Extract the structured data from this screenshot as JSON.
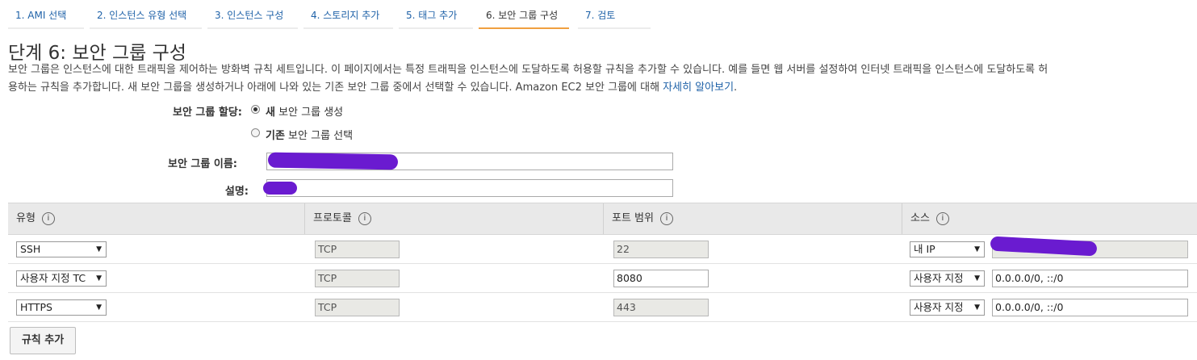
{
  "tabs": [
    {
      "label": "1. AMI 선택"
    },
    {
      "label": "2. 인스턴스 유형 선택"
    },
    {
      "label": "3. 인스턴스 구성"
    },
    {
      "label": "4. 스토리지 추가"
    },
    {
      "label": "5. 태그 추가"
    },
    {
      "label": "6. 보안 그룹 구성"
    },
    {
      "label": "7. 검토"
    }
  ],
  "page": {
    "title": "단계 6: 보안 그룹 구성",
    "description_line1": "보안 그룹은 인스턴스에 대한 트래픽을 제어하는 방화벽 규칙 세트입니다. 이 페이지에서는 특정 트래픽을 인스턴스에 도달하도록 허용할 규칙을 추가할 수 있습니다. 예를 들면 웹 서버를 설정하여 인터넷 트래픽을 인스턴스에 도달하도록 허",
    "description_line2": "용하는 규칙을 추가합니다. 새 보안 그룹을 생성하거나 아래에 나와 있는 기존 보안 그룹 중에서 선택할 수 있습니다. Amazon EC2 보안 그룹에 대해 ",
    "learn_more": "자세히 알아보기",
    "learn_more_suffix": "."
  },
  "form": {
    "assign_label": "보안 그룹 할당:",
    "option_new_bold": "새",
    "option_new_rest": " 보안 그룹 생성",
    "option_existing_bold": "기존",
    "option_existing_rest": " 보안 그룹 선택",
    "name_label": "보안 그룹 이름:",
    "desc_label": "설명:"
  },
  "table": {
    "headers": [
      "유형",
      "프로토콜",
      "포트 범위",
      "소스"
    ],
    "info_glyph": "i",
    "rows": [
      {
        "type": "SSH",
        "protocol": "TCP",
        "port": "22",
        "source": "내 IP",
        "cidr": ""
      },
      {
        "type": "사용자 지정 TC",
        "protocol": "TCP",
        "port": "8080",
        "source": "사용자 지정",
        "cidr": "0.0.0.0/0, ::/0"
      },
      {
        "type": "HTTPS",
        "protocol": "TCP",
        "port": "443",
        "source": "사용자 지정",
        "cidr": "0.0.0.0/0, ::/0"
      }
    ]
  },
  "add_rule_button": "규칙 추가",
  "colors": {
    "link": "#1f62a8",
    "active_tab": "#f0a040",
    "redaction": "#6a1bd0"
  }
}
